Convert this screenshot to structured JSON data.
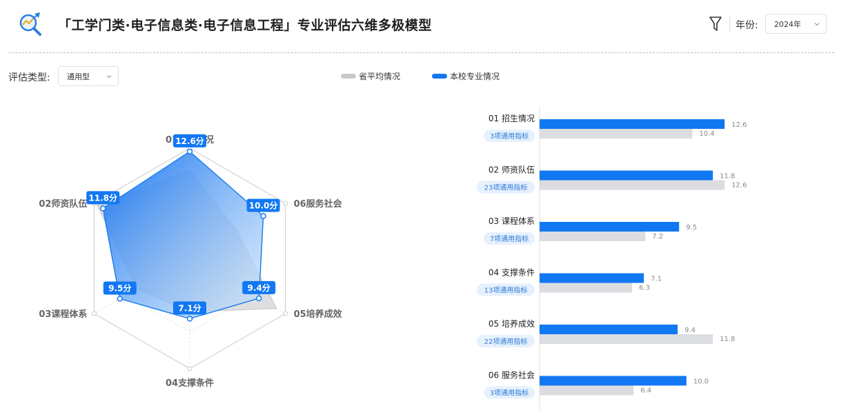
{
  "header": {
    "title": "「工学门类·电子信息类·电子信息工程」专业评估六维多极模型",
    "year_label": "年份:",
    "year_value": "2024年"
  },
  "filter": {
    "type_label": "评估类型:",
    "type_value": "通用型"
  },
  "legend": {
    "avg_label": "省平均情况",
    "school_label": "本校专业情况"
  },
  "colors": {
    "school": "#1278f2",
    "avg": "#dcdde1",
    "badge_bg": "#e6f1fd",
    "badge_text": "#2f7bd6"
  },
  "chart_data": [
    {
      "type": "radar",
      "axes": [
        "01招生情况",
        "02师资队伍",
        "03课程体系",
        "04支撑条件",
        "05培养成效",
        "06服务社会"
      ],
      "max": 13,
      "series": [
        {
          "name": "本校专业情况",
          "values": [
            12.6,
            11.8,
            9.5,
            7.1,
            9.4,
            10.0
          ]
        },
        {
          "name": "省平均情况",
          "values": [
            10.4,
            12.6,
            7.2,
            6.3,
            11.8,
            6.4
          ]
        }
      ],
      "value_labels": [
        "12.6分",
        "11.8分",
        "9.5分",
        "7.1分",
        "9.4分",
        "10.0分"
      ]
    },
    {
      "type": "bar",
      "orientation": "horizontal",
      "categories": [
        "01 招生情况",
        "02 师资队伍",
        "03 课程体系",
        "04 支撑条件",
        "05 培养成效",
        "06 服务社会"
      ],
      "badges": [
        "3项通用指标",
        "23项通用指标",
        "7项通用指标",
        "13项通用指标",
        "22项通用指标",
        "3项通用指标"
      ],
      "series": [
        {
          "name": "本校专业情况",
          "values": [
            12.6,
            11.8,
            9.5,
            7.1,
            9.4,
            10.0
          ],
          "labels": [
            "12.6",
            "11.8",
            "9.5",
            "7.1",
            "9.4",
            "10.0"
          ]
        },
        {
          "name": "省平均情况",
          "values": [
            10.4,
            12.6,
            7.2,
            6.3,
            11.8,
            6.4
          ],
          "labels": [
            "10.4",
            "12.6",
            "7.2",
            "6.3",
            "11.8",
            "6.4"
          ]
        }
      ],
      "xlim": [
        0,
        14
      ]
    }
  ]
}
